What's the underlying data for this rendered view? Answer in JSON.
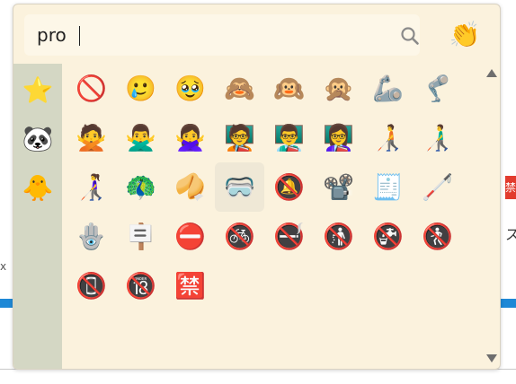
{
  "background": {
    "edge_glyph": "x",
    "right_glyph": "ス",
    "right_red_glyph": "禁"
  },
  "search": {
    "value": "pro",
    "icon": "search-icon"
  },
  "skin_tone": {
    "emoji": "👏"
  },
  "sidebar": {
    "items": [
      {
        "name": "favorites",
        "emoji": "⭐"
      },
      {
        "name": "custom-sticker-1",
        "emoji": "🐼"
      },
      {
        "name": "custom-sticker-2",
        "emoji": "🐥"
      }
    ]
  },
  "results": {
    "rows": [
      [
        {
          "emoji": "🚫",
          "name": "prohibited"
        },
        {
          "emoji": "🥲",
          "name": "smiling-face-with-tear"
        },
        {
          "emoji": "🥹",
          "name": "face-holding-back-tears"
        },
        {
          "emoji": "🙈",
          "name": "see-no-evil-monkey"
        },
        {
          "emoji": "🙉",
          "name": "hear-no-evil-monkey"
        },
        {
          "emoji": "🙊",
          "name": "speak-no-evil-monkey"
        },
        {
          "emoji": "🦾",
          "name": "mechanical-arm"
        },
        {
          "emoji": "🦿",
          "name": "mechanical-leg"
        }
      ],
      [
        {
          "emoji": "🙅",
          "name": "person-gesturing-no"
        },
        {
          "emoji": "🙅‍♂️",
          "name": "man-gesturing-no"
        },
        {
          "emoji": "🙅‍♀️",
          "name": "woman-gesturing-no"
        },
        {
          "emoji": "🧑‍🏫",
          "name": "teacher"
        },
        {
          "emoji": "👨‍🏫",
          "name": "man-teacher"
        },
        {
          "emoji": "👩‍🏫",
          "name": "woman-teacher"
        },
        {
          "emoji": "🧑‍🦯",
          "name": "person-with-white-cane"
        },
        {
          "emoji": "👨‍🦯",
          "name": "man-with-white-cane"
        }
      ],
      [
        {
          "emoji": "👩‍🦯",
          "name": "woman-with-white-cane"
        },
        {
          "emoji": "🦚",
          "name": "peacock"
        },
        {
          "emoji": "🥠",
          "name": "fortune-cookie"
        },
        {
          "emoji": "🥽",
          "name": "goggles"
        },
        {
          "emoji": "🔕",
          "name": "bell-with-slash"
        },
        {
          "emoji": "📽️",
          "name": "film-projector"
        },
        {
          "emoji": "🧾",
          "name": "receipt"
        },
        {
          "emoji": "🦯",
          "name": "white-cane"
        }
      ],
      [
        {
          "emoji": "🪬",
          "name": "hamsa"
        },
        {
          "emoji": "🪧",
          "name": "placard"
        },
        {
          "emoji": "⛔",
          "name": "no-entry"
        },
        {
          "emoji": "🚳",
          "name": "no-bicycles"
        },
        {
          "emoji": "🚭",
          "name": "no-smoking"
        },
        {
          "emoji": "🚯",
          "name": "no-littering"
        },
        {
          "emoji": "🚱",
          "name": "non-potable-water"
        },
        {
          "emoji": "🚷",
          "name": "no-pedestrians"
        }
      ],
      [
        {
          "emoji": "📵",
          "name": "no-mobile-phones"
        },
        {
          "emoji": "🔞",
          "name": "no-one-under-eighteen"
        },
        {
          "emoji": "🈲",
          "name": "japanese-prohibited-button"
        }
      ]
    ],
    "highlighted": "goggles"
  },
  "colors": {
    "panel": "#fbf2dd",
    "sidebar": "#d4d7c4",
    "highlight": "#efe8d6",
    "accent_blue": "#1e88d6"
  }
}
